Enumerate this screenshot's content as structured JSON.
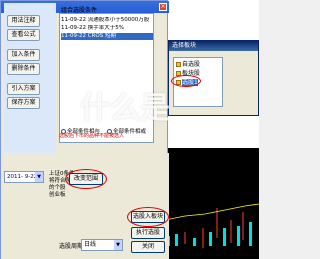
{
  "dialog": {
    "group_label": "组合选股条件",
    "left_buttons": [
      "用法注释",
      "查看公式",
      "加入条件",
      "删除条件",
      "引入方案",
      "保存方案"
    ],
    "conditions": [
      {
        "text": "11-09-22 流通股本小于50000万股",
        "selected": false
      },
      {
        "text": "11-09-22 换手率大于5%",
        "selected": false
      },
      {
        "text": "11-09-22 CROS 短期",
        "selected": true
      }
    ],
    "radio_and": "全部条件相与",
    "radio_or": "全部条件相或",
    "note": "选股后下市的品种不能被选入",
    "date_value": "2011- 9-22",
    "description_lines": [
      "上证0条件",
      "将符合条件",
      "的个股",
      "创业板"
    ],
    "btn_change": "改变范围",
    "btn_select_to_block": "选股入板块",
    "btn_run": "执行选股",
    "period_label": "选股周期:",
    "period_value": "日线",
    "btn_close": "关闭"
  },
  "dlg2": {
    "title": "选择板块",
    "items": [
      {
        "label": "自选股",
        "selected": false
      },
      {
        "label": "板块股",
        "selected": false
      },
      {
        "label": "选股1",
        "selected": true
      }
    ]
  },
  "watermark": "什么是"
}
